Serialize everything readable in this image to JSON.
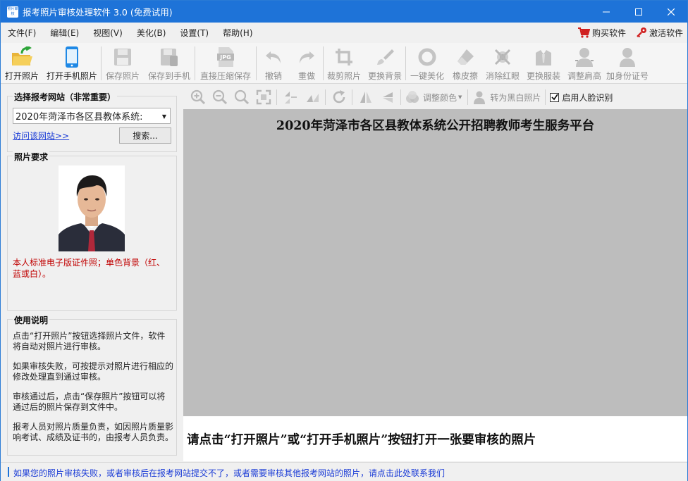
{
  "window": {
    "icon_text": "照片审核",
    "title": "报考照片审核处理软件 3.0 (免费试用)"
  },
  "menu": {
    "items": [
      "文件(F)",
      "编辑(E)",
      "视图(V)",
      "美化(B)",
      "设置(T)",
      "帮助(H)"
    ],
    "buy": "购买软件",
    "activate": "激活软件"
  },
  "toolbar": {
    "open_photo": "打开照片",
    "open_phone": "打开手机照片",
    "save_photo": "保存照片",
    "save_to_phone": "保存到手机",
    "compress_save": "直接压缩保存",
    "undo": "撤销",
    "redo": "重做",
    "crop": "裁剪照片",
    "change_bg": "更换背景",
    "beautify": "一键美化",
    "eraser": "橡皮擦",
    "remove_redeye": "消除红眼",
    "change_clothes": "更换服装",
    "adjust_shoulder": "调整肩高",
    "add_id": "加身份证号"
  },
  "left": {
    "site_group_title": "选择报考网站（非常重要）",
    "site_selected": "2020年菏泽市各区县教体系统:",
    "visit_link": "访问该网站>>",
    "search_btn": "搜索...",
    "req_group_title": "照片要求",
    "req_text": "本人标准电子版证件照；单色背景（红、蓝或白）。",
    "instr_group_title": "使用说明",
    "instr": [
      "点击“打开照片”按钮选择照片文件，软件将自动对照片进行审核。",
      "如果审核失败，可按提示对照片进行相应的修改处理直到通过审核。",
      "审核通过后，点击“保存照片”按钮可以将通过后的照片保存到文件中。",
      "报考人员对照片质量负责，如因照片质量影响考试、成绩及证书的，由报考人员负责。"
    ]
  },
  "image_toolbar": {
    "adjust_color": "调整颜色",
    "to_bw": "转为黑白照片",
    "face_detect": "启用人脸识别",
    "face_detect_checked": true
  },
  "canvas": {
    "site_title": "2020年菏泽市各区县教体系统公开招聘教师考生服务平台",
    "prompt": "请点击“打开照片”或“打开手机照片”按钮打开一张要审核的照片"
  },
  "status": {
    "text": "如果您的照片审核失败，或者审核后在报考网站提交不了，或者需要审核其他报考网站的照片，请点击此处联系我们"
  },
  "colors": {
    "titlebar": "#1e73d8",
    "link": "#1a3bd6",
    "requirement_text": "#c00000",
    "canvas_bg": "#bdbdbd"
  }
}
